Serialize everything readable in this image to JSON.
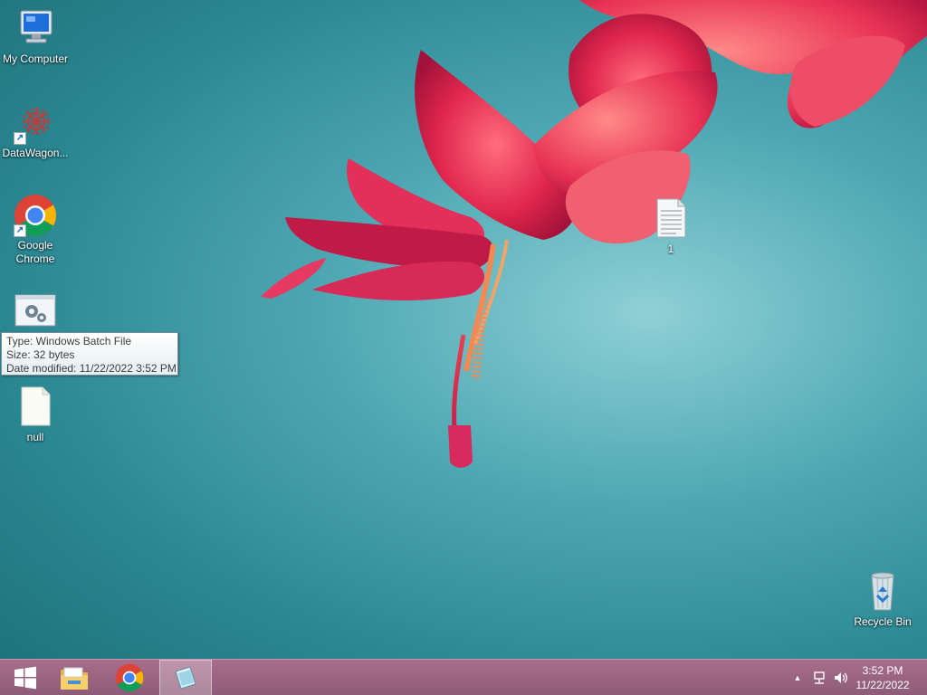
{
  "desktop": {
    "icons": [
      {
        "label": "My Computer",
        "icon": "my-computer-icon"
      },
      {
        "label": "DataWagon...",
        "icon": "datawagon-icon"
      },
      {
        "label": "Google Chrome",
        "icon": "chrome-icon"
      },
      {
        "label": "",
        "icon": "batch-file-icon"
      },
      {
        "label": "null",
        "icon": "blank-file-icon"
      },
      {
        "label": "1",
        "icon": "text-file-icon"
      },
      {
        "label": "Recycle Bin",
        "icon": "recycle-bin-icon"
      }
    ],
    "tooltip": {
      "type_line": "Type: Windows Batch File",
      "size_line": "Size: 32 bytes",
      "date_line": "Date modified: 11/22/2022 3:52 PM"
    }
  },
  "taskbar": {
    "buttons": [
      {
        "icon": "windows-start-icon"
      },
      {
        "icon": "file-explorer-icon"
      },
      {
        "icon": "chrome-icon"
      },
      {
        "icon": "notepad-icon",
        "active": true
      }
    ],
    "tray": {
      "icons": [
        "show-hidden-icons-icon",
        "network-icon",
        "volume-icon"
      ]
    },
    "clock": {
      "time": "3:52 PM",
      "date": "11/22/2022"
    }
  },
  "colors": {
    "wallpaper": "#2a8791",
    "flower": "#d9234a",
    "taskbar": "#9a6582"
  }
}
